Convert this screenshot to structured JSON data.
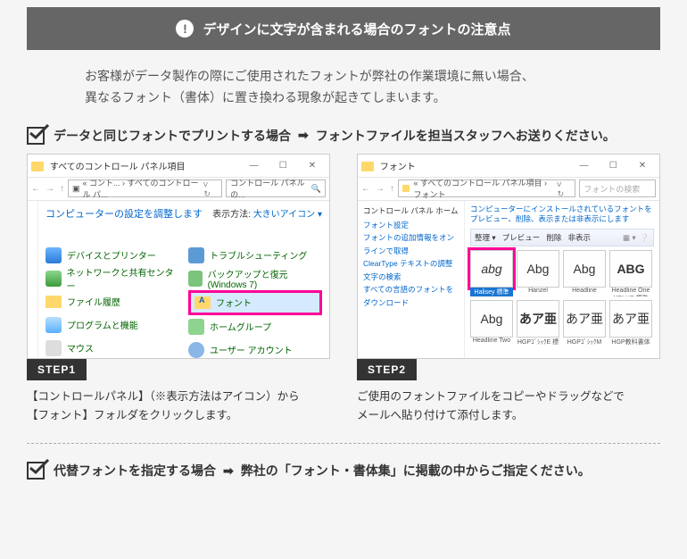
{
  "banner": {
    "icon": "exclamation",
    "text": "デザインに文字が含まれる場合のフォントの注意点"
  },
  "intro": "お客様がデータ製作の際にご使用されたフォントが弊社の作業環境に無い場合、\n異なるフォント（書体）に置き換わる現象が起きてしまいます。",
  "section1": {
    "title_a": "データと同じフォントでプリントする場合",
    "arrow": "➡",
    "title_b": "フォントファイルを担当スタッフへお送りください。"
  },
  "step1": {
    "badge": "STEP1",
    "shot": {
      "title": "すべてのコントロール パネル項目",
      "path": "« コント... › すべてのコントロール パ...",
      "search_placeholder": "コントロール パネルの...",
      "header": "コンピューターの設定を調整します",
      "view_label": "表示方法:",
      "view_value": "大きいアイコン ▾",
      "left": [
        {
          "icon": "device",
          "label": "デバイスとプリンター"
        },
        {
          "icon": "net",
          "label": "ネットワークと共有センター"
        },
        {
          "icon": "filehist",
          "label": "ファイル履歴"
        },
        {
          "icon": "prog",
          "label": "プログラムと機能"
        },
        {
          "icon": "mouse",
          "label": "マウス"
        }
      ],
      "right": [
        {
          "icon": "trouble",
          "label": "トラブルシューティング"
        },
        {
          "icon": "backup",
          "label": "バックアップと復元 (Windows 7)"
        },
        {
          "icon": "font",
          "label": "フォント",
          "highlight": true
        },
        {
          "icon": "home",
          "label": "ホームグループ"
        },
        {
          "icon": "user",
          "label": "ユーザー アカウント"
        }
      ]
    },
    "desc": "【コントロールパネル】（※表示方法はアイコン）から\n【フォント】フォルダをクリックします。"
  },
  "step2": {
    "badge": "STEP2",
    "shot": {
      "title": "フォント",
      "path": "« すべてのコントロール パネル項目 › フォント",
      "search_placeholder": "フォントの検索",
      "left_header": "コントロール パネル ホーム",
      "left_links": [
        "フォント設定",
        "フォントの追加情報をオンラインで取得",
        "ClearType テキストの調整",
        "文字の検索",
        "すべての言語のフォントをダウンロード"
      ],
      "right_desc": "コンピューターにインストールされているフォントをプレビュー、削除、表示または非表示にします",
      "toolbar": {
        "a": "整理 ▾",
        "b": "プレビュー",
        "c": "削除",
        "d": "非表示"
      },
      "grid_row1": [
        {
          "glyph": "abg",
          "label": "Halisey 標準",
          "style": "italic",
          "sel": true
        },
        {
          "glyph": "Abg",
          "label": "Hanzel",
          "style": ""
        },
        {
          "glyph": "Abg",
          "label": "Headline",
          "style": ""
        },
        {
          "glyph": "ABG",
          "label": "Headline One HPLHS 標準",
          "style": "bold"
        }
      ],
      "grid_row2": [
        {
          "glyph": "Abg",
          "label": "Headline Two",
          "style": ""
        },
        {
          "glyph": "あア亜",
          "label": "HGPｺﾞｼｯｸE 標準",
          "style": "bold"
        },
        {
          "glyph": "あア亜",
          "label": "HGPｺﾞｼｯｸM",
          "style": ""
        },
        {
          "glyph": "あア亜",
          "label": "HGP教科書体",
          "style": ""
        }
      ]
    },
    "desc": "ご使用のフォントファイルをコピーやドラッグなどで\nメールへ貼り付けて添付します。"
  },
  "section2": {
    "title_a": "代替フォントを指定する場合",
    "arrow": "➡",
    "title_b": "弊社の「フォント・書体集」に掲載の中からご指定ください。"
  }
}
